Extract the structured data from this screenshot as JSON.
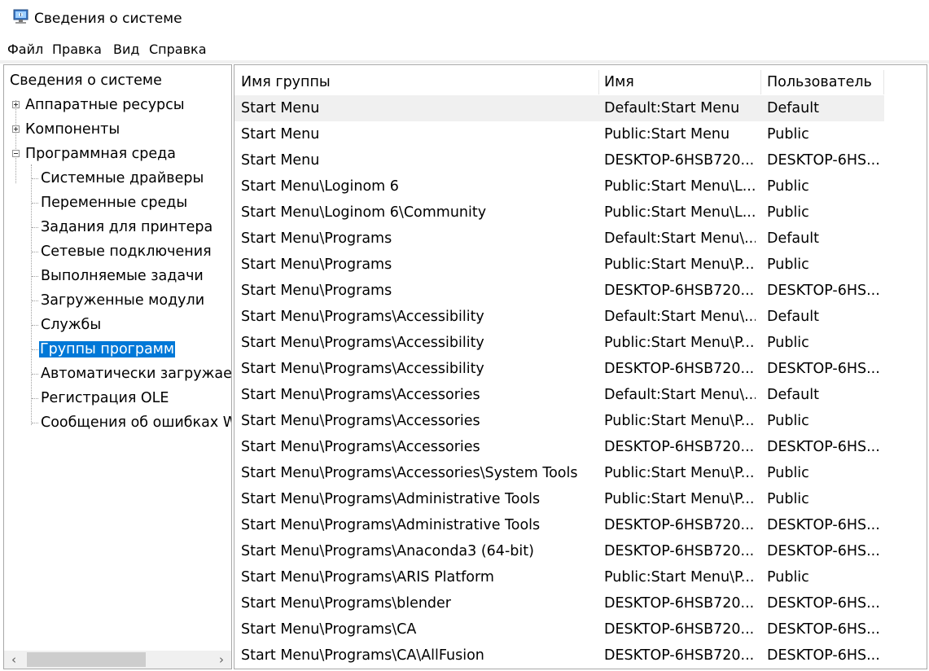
{
  "window": {
    "title": "Сведения о системе",
    "icon": "system-info-icon"
  },
  "menu": [
    "Файл",
    "Правка",
    "Вид",
    "Справка"
  ],
  "tree": {
    "root": "Сведения о системе",
    "nodes": [
      {
        "label": "Аппаратные ресурсы",
        "state": "collapsed"
      },
      {
        "label": "Компоненты",
        "state": "collapsed"
      },
      {
        "label": "Программная среда",
        "state": "expanded"
      }
    ],
    "children": [
      "Системные драйверы",
      "Переменные среды",
      "Задания для принтера",
      "Сетевые подключения",
      "Выполняемые задачи",
      "Загруженные модули",
      "Службы",
      "Группы программ",
      "Автоматически загружаем",
      "Регистрация OLE",
      "Сообщения об ошибках W"
    ],
    "selected": "Группы программ"
  },
  "table": {
    "columns": [
      "Имя группы",
      "Имя",
      "Пользователь"
    ],
    "rows": [
      [
        "Start Menu",
        "Default:Start Menu",
        "Default"
      ],
      [
        "Start Menu",
        "Public:Start Menu",
        "Public"
      ],
      [
        "Start Menu",
        "DESKTOP-6HSB720...",
        "DESKTOP-6HS..."
      ],
      [
        "Start Menu\\Loginom 6",
        "Public:Start Menu\\L...",
        "Public"
      ],
      [
        "Start Menu\\Loginom 6\\Community",
        "Public:Start Menu\\L...",
        "Public"
      ],
      [
        "Start Menu\\Programs",
        "Default:Start Menu\\...",
        "Default"
      ],
      [
        "Start Menu\\Programs",
        "Public:Start Menu\\P...",
        "Public"
      ],
      [
        "Start Menu\\Programs",
        "DESKTOP-6HSB720...",
        "DESKTOP-6HS..."
      ],
      [
        "Start Menu\\Programs\\Accessibility",
        "Default:Start Menu\\...",
        "Default"
      ],
      [
        "Start Menu\\Programs\\Accessibility",
        "Public:Start Menu\\P...",
        "Public"
      ],
      [
        "Start Menu\\Programs\\Accessibility",
        "DESKTOP-6HSB720...",
        "DESKTOP-6HS..."
      ],
      [
        "Start Menu\\Programs\\Accessories",
        "Default:Start Menu\\...",
        "Default"
      ],
      [
        "Start Menu\\Programs\\Accessories",
        "Public:Start Menu\\P...",
        "Public"
      ],
      [
        "Start Menu\\Programs\\Accessories",
        "DESKTOP-6HSB720...",
        "DESKTOP-6HS..."
      ],
      [
        "Start Menu\\Programs\\Accessories\\System Tools",
        "Public:Start Menu\\P...",
        "Public"
      ],
      [
        "Start Menu\\Programs\\Administrative Tools",
        "Public:Start Menu\\P...",
        "Public"
      ],
      [
        "Start Menu\\Programs\\Administrative Tools",
        "DESKTOP-6HSB720...",
        "DESKTOP-6HS..."
      ],
      [
        "Start Menu\\Programs\\Anaconda3 (64-bit)",
        "DESKTOP-6HSB720...",
        "DESKTOP-6HS..."
      ],
      [
        "Start Menu\\Programs\\ARIS Platform",
        "Public:Start Menu\\P...",
        "Public"
      ],
      [
        "Start Menu\\Programs\\blender",
        "DESKTOP-6HSB720...",
        "DESKTOP-6HS..."
      ],
      [
        "Start Menu\\Programs\\CA",
        "DESKTOP-6HSB720...",
        "DESKTOP-6HS..."
      ],
      [
        "Start Menu\\Programs\\CA\\AllFusion",
        "DESKTOP-6HSB720...",
        "DESKTOP-6HS..."
      ]
    ],
    "highlighted_row": 0
  },
  "scrollbar": {
    "left_arrow": "‹",
    "right_arrow": "›"
  },
  "colors": {
    "selection": "#0078d7",
    "row_highlight": "#f0f0f0",
    "border": "#a8a8a8"
  }
}
